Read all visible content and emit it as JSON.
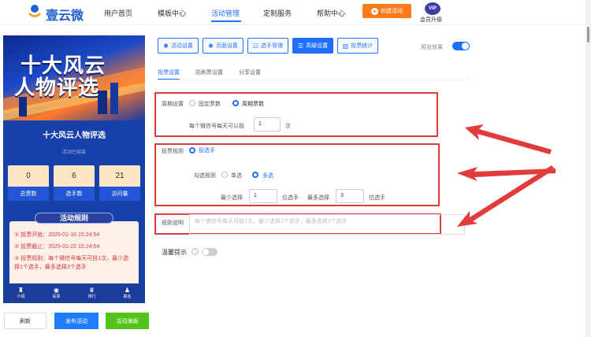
{
  "brand": {
    "name": "壹云微"
  },
  "nav": {
    "items": [
      "用户首页",
      "模板中心",
      "活动管理",
      "定制服务",
      "帮助中心"
    ],
    "create_label": "创建活动",
    "vip_badge": "VIP",
    "vip_label": "会员升级"
  },
  "preview": {
    "banner_line1": "十大风云",
    "banner_line2": "人物评选",
    "activity_title": "十大风云人物评选",
    "activity_status": "活动已结束",
    "stats": [
      {
        "value": "0",
        "label": "总票数"
      },
      {
        "value": "6",
        "label": "选手数"
      },
      {
        "value": "21",
        "label": "访问量"
      }
    ],
    "rules_title": "活动规则",
    "rules": [
      "① 投票开始：2025-01-16 15:24:54",
      "② 投票截止：2025-01-22 15:24:54",
      "③ 投票规则：每个微信号每天可投1次，最少选择1个选手，最多选择3个选手"
    ],
    "tabbar": [
      {
        "icon": "♜",
        "label": "介绍"
      },
      {
        "icon": "◉",
        "label": "投票"
      },
      {
        "icon": "♛",
        "label": "排行"
      },
      {
        "icon": "♟",
        "label": "报名"
      }
    ]
  },
  "actions": {
    "refresh": "刷新",
    "publish": "发布活动",
    "poster": "活动海报"
  },
  "toolbar": {
    "buttons": [
      "活动设置",
      "页面设置",
      "选手管理",
      "高级设置",
      "投票统计"
    ],
    "preview_label": "预览效果"
  },
  "subtabs": [
    "投票设置",
    "防刷票设置",
    "分享设置"
  ],
  "form": {
    "period": {
      "label": "周期设置",
      "options": [
        "固定票数",
        "周期票数"
      ],
      "per_day_label": "每个微信号每天可以投",
      "per_day_value": "1",
      "unit": "次"
    },
    "vote_rule": {
      "label": "投票规则",
      "option": "投选手",
      "select_rule_label": "勾选规则",
      "select_options": [
        "单选",
        "多选"
      ],
      "min_label": "最少选择",
      "min_value": "1",
      "min_unit": "位选手",
      "max_label": "最多选择",
      "max_value": "3",
      "max_unit": "位选手"
    },
    "rule_desc": {
      "label": "规则说明",
      "placeholder": "每个微信号每天可投1次，最少选择1个选手，最多选择3个选手"
    },
    "tip": {
      "label": "温馨提示"
    }
  },
  "colors": {
    "accent": "#1f6fff",
    "highlight": "#e23b3b",
    "create": "#ff7a1a",
    "poster": "#52c41a"
  }
}
